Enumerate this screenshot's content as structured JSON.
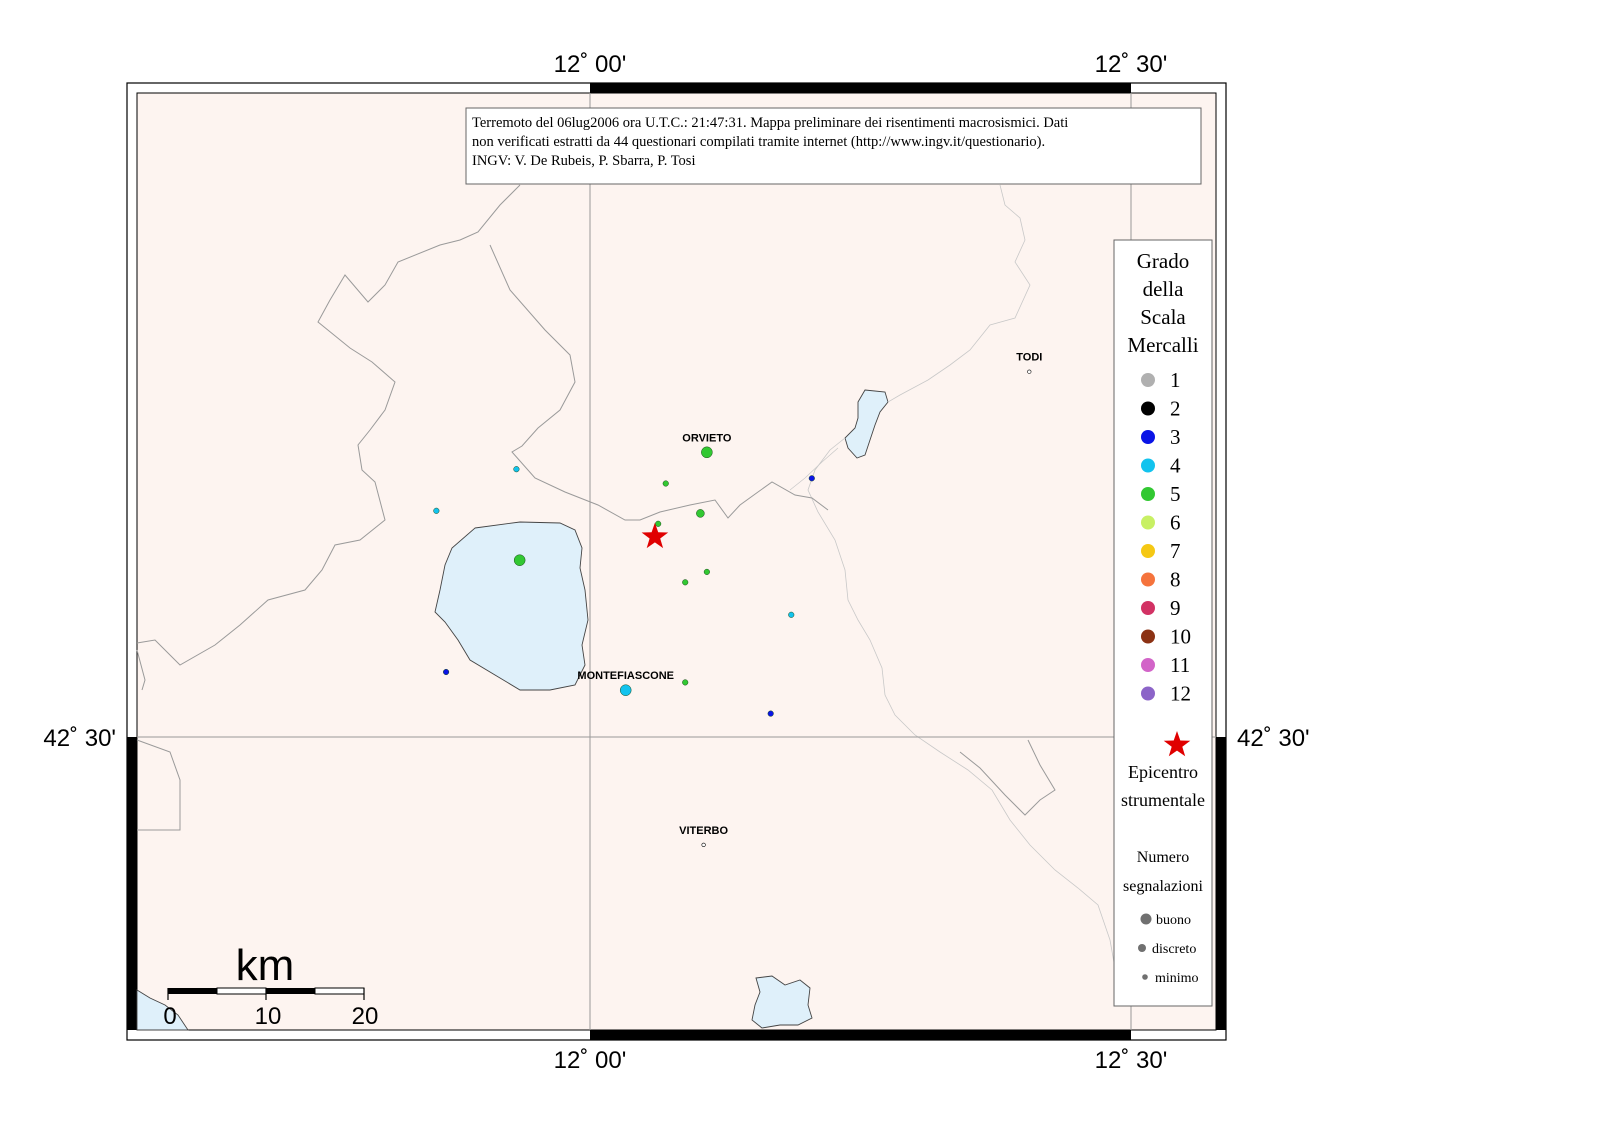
{
  "map": {
    "lon_labels": {
      "left": "12˚ 00'",
      "right": "12˚ 30'"
    },
    "lat_label": "42˚ 30'"
  },
  "info_box": {
    "lines": [
      "Terremoto del 06lug2006 ora U.T.C.: 21:47:31.  Mappa preliminare dei risentimenti macrosismici.  Dati",
      "non verificati estratti da 44 questionari compilati tramite internet (http://www.ingv.it/questionario).",
      "INGV: V.  De Rubeis, P.  Sbarra, P.  Tosi"
    ]
  },
  "cities": [
    {
      "name": "TODI",
      "lon": 12.406,
      "lat": 42.781
    },
    {
      "name": "ORVIETO",
      "lon": 12.108,
      "lat": 42.719
    },
    {
      "name": "MONTEFIASCONE",
      "lon": 12.033,
      "lat": 42.536
    },
    {
      "name": "VITERBO",
      "lon": 12.105,
      "lat": 42.417
    }
  ],
  "epicenter": {
    "lon": 12.06,
    "lat": 42.654
  },
  "observations": [
    {
      "lon": 12.108,
      "lat": 42.719,
      "intensity": 5,
      "reports": "buono"
    },
    {
      "lon": 12.102,
      "lat": 42.672,
      "intensity": 5,
      "reports": "discreto"
    },
    {
      "lon": 12.07,
      "lat": 42.695,
      "intensity": 5,
      "reports": "minimo"
    },
    {
      "lon": 12.063,
      "lat": 42.664,
      "intensity": 5,
      "reports": "minimo"
    },
    {
      "lon": 11.935,
      "lat": 42.636,
      "intensity": 5,
      "reports": "buono"
    },
    {
      "lon": 12.108,
      "lat": 42.627,
      "intensity": 5,
      "reports": "minimo"
    },
    {
      "lon": 12.088,
      "lat": 42.619,
      "intensity": 5,
      "reports": "minimo"
    },
    {
      "lon": 12.088,
      "lat": 42.542,
      "intensity": 5,
      "reports": "minimo"
    },
    {
      "lon": 11.932,
      "lat": 42.706,
      "intensity": 4,
      "reports": "minimo"
    },
    {
      "lon": 11.858,
      "lat": 42.674,
      "intensity": 4,
      "reports": "minimo"
    },
    {
      "lon": 12.186,
      "lat": 42.594,
      "intensity": 4,
      "reports": "minimo"
    },
    {
      "lon": 12.033,
      "lat": 42.536,
      "intensity": 4,
      "reports": "buono"
    },
    {
      "lon": 12.205,
      "lat": 42.699,
      "intensity": 3,
      "reports": "minimo"
    },
    {
      "lon": 11.867,
      "lat": 42.55,
      "intensity": 3,
      "reports": "minimo"
    },
    {
      "lon": 12.167,
      "lat": 42.518,
      "intensity": 3,
      "reports": "minimo"
    }
  ],
  "legend": {
    "title_lines": [
      "Grado",
      "della",
      "Scala",
      "Mercalli"
    ],
    "classes": [
      {
        "label": "1",
        "color": "#b0b0b0"
      },
      {
        "label": "2",
        "color": "#000000"
      },
      {
        "label": "3",
        "color": "#0a14e6"
      },
      {
        "label": "4",
        "color": "#12c3ee"
      },
      {
        "label": "5",
        "color": "#32c832"
      },
      {
        "label": "6",
        "color": "#c8f064"
      },
      {
        "label": "7",
        "color": "#f5c814"
      },
      {
        "label": "8",
        "color": "#f5733c"
      },
      {
        "label": "9",
        "color": "#d23264"
      },
      {
        "label": "10",
        "color": "#8c3214"
      },
      {
        "label": "11",
        "color": "#d264c8"
      },
      {
        "label": "12",
        "color": "#8c64c8"
      }
    ],
    "epicenter_label_lines": [
      "Epicentro",
      "strumentale"
    ],
    "reports_title_lines": [
      "Numero",
      "segnalazioni"
    ],
    "report_sizes": [
      {
        "label": "buono"
      },
      {
        "label": "discreto"
      },
      {
        "label": "minimo"
      }
    ]
  },
  "scale_bar": {
    "unit": "km",
    "ticks": [
      "0",
      "10",
      "20"
    ]
  },
  "colors": {
    "land": "#fdf4f0",
    "lake": "#dff0fa",
    "border": "#9a9a9a",
    "river": "#c8c8c8",
    "epicenter": "#e00000",
    "epicenter_text": "#c00000"
  }
}
